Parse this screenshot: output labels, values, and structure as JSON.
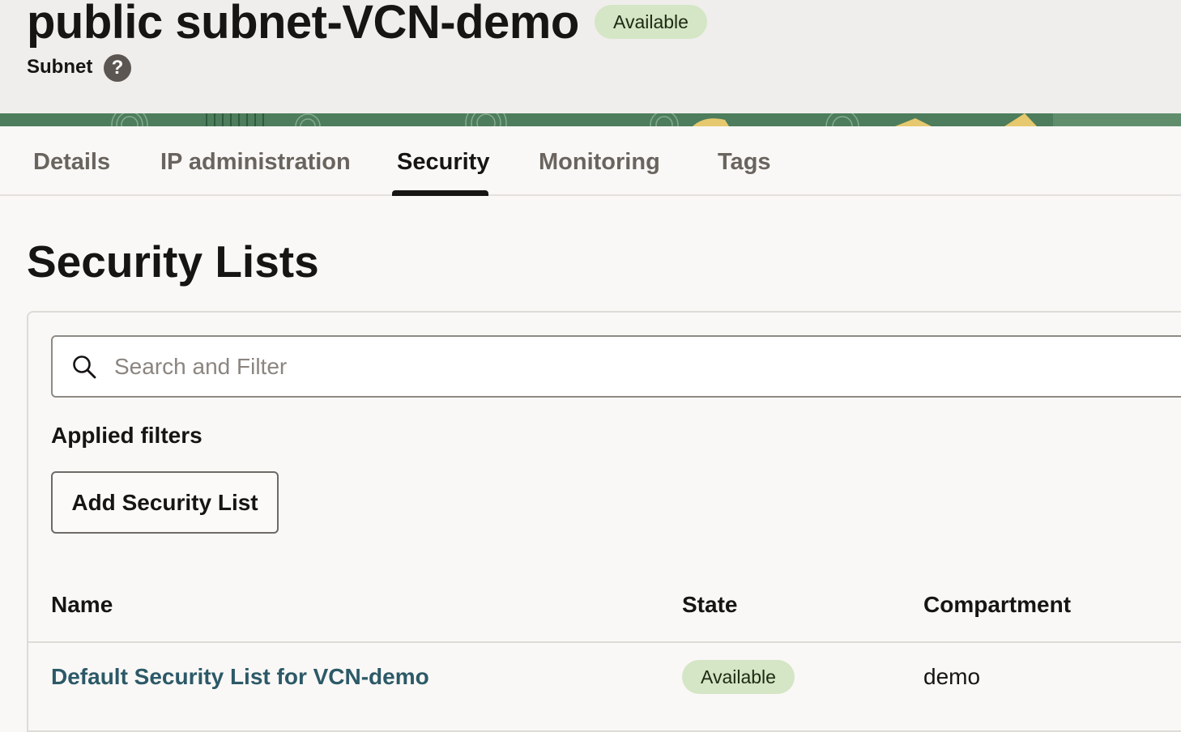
{
  "header": {
    "title": "public subnet-VCN-demo",
    "status": "Available",
    "subtitle": "Subnet",
    "help_glyph": "?"
  },
  "tabs": [
    {
      "label": "Details",
      "active": false
    },
    {
      "label": "IP administration",
      "active": false
    },
    {
      "label": "Security",
      "active": true
    },
    {
      "label": "Monitoring",
      "active": false
    },
    {
      "label": "Tags",
      "active": false
    }
  ],
  "section": {
    "title": "Security Lists"
  },
  "search": {
    "placeholder": "Search and Filter",
    "value": ""
  },
  "filters": {
    "label": "Applied filters"
  },
  "actions": {
    "add_label": "Add Security List"
  },
  "table": {
    "columns": [
      "Name",
      "State",
      "Compartment"
    ],
    "rows": [
      {
        "name": "Default Security List for VCN-demo",
        "state": "Available",
        "compartment": "demo"
      }
    ]
  },
  "colors": {
    "badge_bg": "#d4e6c5",
    "link": "#2c5967",
    "header_bg": "#efeeec",
    "banner": "#4a7a5a"
  },
  "icons": {
    "help": "help-circle-icon",
    "search": "search-icon"
  }
}
